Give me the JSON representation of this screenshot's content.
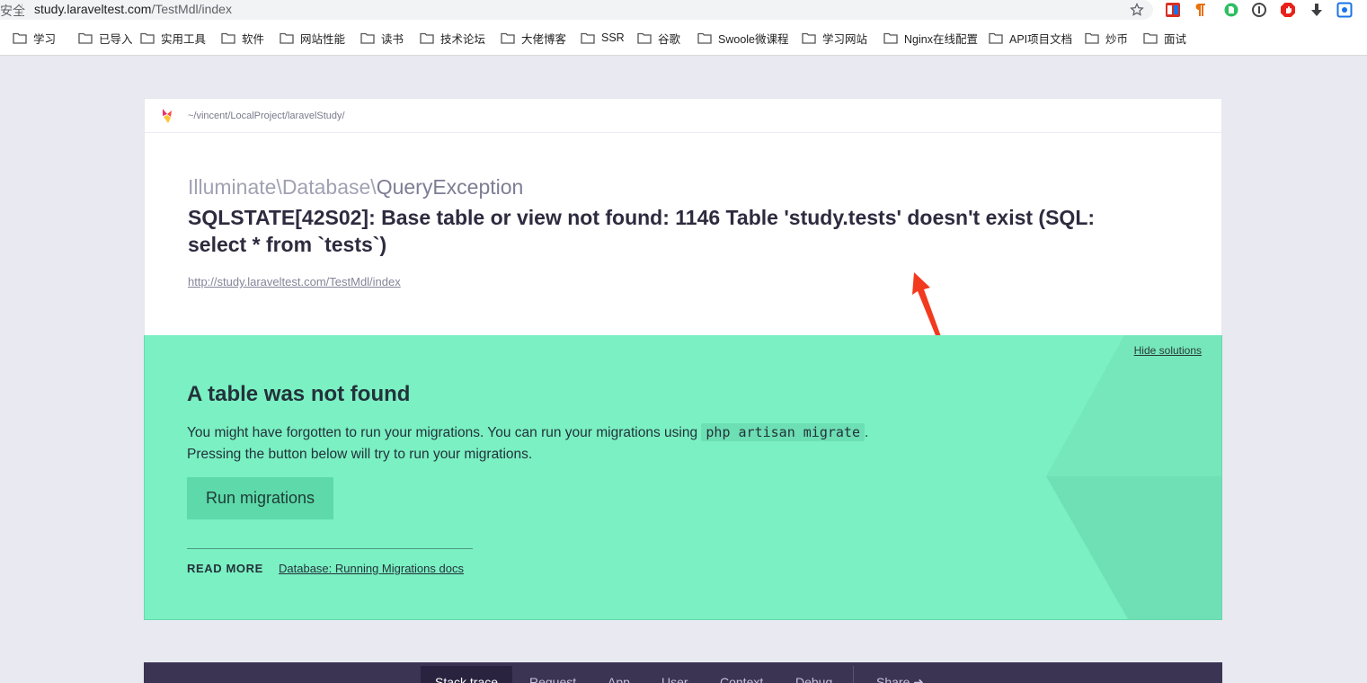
{
  "browser": {
    "secure_label": "安全",
    "url_host": "study.laraveltest.com",
    "url_path": "/TestMdl/index"
  },
  "bookmarks": [
    "学习",
    "已导入",
    "实用工具",
    "软件",
    "网站性能",
    "读书",
    "技术论坛",
    "大佬博客",
    "SSR",
    "谷歌",
    "Swoole微课程",
    "学习网站",
    "Nginx在线配置",
    "API项目文档",
    "炒币",
    "面试"
  ],
  "header": {
    "project_path": "~/vincent/LocalProject/laravelStudy/"
  },
  "exception": {
    "class_prefix": "Illuminate\\Database\\",
    "class_name": "QueryException",
    "message": "SQLSTATE[42S02]: Base table or view not found: 1146 Table 'study.tests' doesn't exist (SQL: select * from `tests`)",
    "url": "http://study.laraveltest.com/TestMdl/index"
  },
  "solution": {
    "hide_label": "Hide solutions",
    "title": "A table was not found",
    "text_before_code": "You might have forgotten to run your migrations. You can run your migrations using ",
    "code": "php artisan migrate",
    "text_after_code": ".",
    "text_line2": "Pressing the button below will try to run your migrations.",
    "button_label": "Run migrations",
    "read_more_label": "READ MORE",
    "read_more_link": "Database: Running Migrations docs"
  },
  "nav": {
    "tabs": [
      "Stack trace",
      "Request",
      "App",
      "User",
      "Context",
      "Debug"
    ],
    "share_label": "Share"
  },
  "colors": {
    "solution_bg": "#7bf0c3",
    "nav_bg": "#3c3453",
    "arrow": "#f23a1f"
  }
}
